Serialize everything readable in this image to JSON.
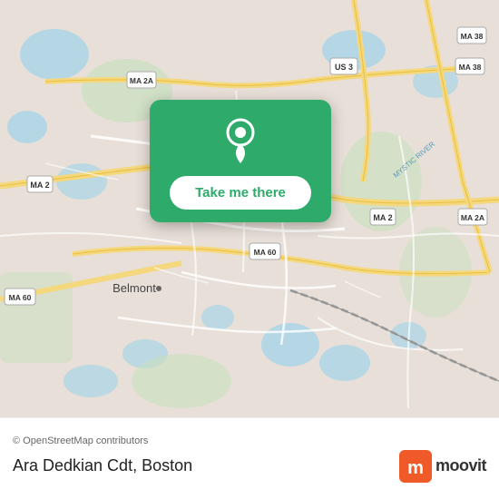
{
  "map": {
    "attribution": "© OpenStreetMap contributors",
    "location_label": "Belmont"
  },
  "card": {
    "button_label": "Take me there",
    "pin_color": "#ffffff"
  },
  "bottom_bar": {
    "title": "Ara Dedkian Cdt",
    "city": "Boston",
    "moovit_label": "moovit",
    "attribution": "© OpenStreetMap contributors"
  },
  "colors": {
    "green": "#2eaa6a",
    "moovit_orange": "#f05a28"
  }
}
